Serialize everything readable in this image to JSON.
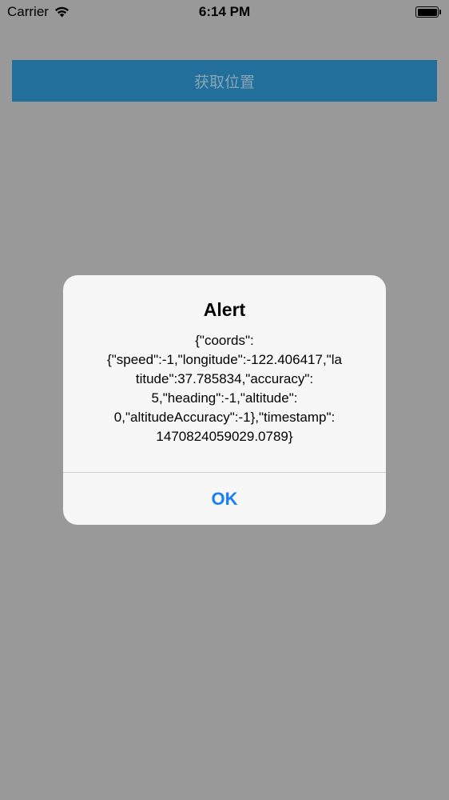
{
  "status_bar": {
    "carrier": "Carrier",
    "time": "6:14 PM",
    "wifi_icon": "wifi-icon",
    "battery_icon": "battery-icon"
  },
  "main": {
    "location_button_label": "获取位置"
  },
  "alert": {
    "title": "Alert",
    "message": "{\"coords\":\n{\"speed\":-1,\"longitude\":-122.406417,\"la\ntitude\":37.785834,\"accuracy\":\n5,\"heading\":-1,\"altitude\":\n0,\"altitudeAccuracy\":-1},\"timestamp\":\n1470824059029.0789}",
    "message_lines": [
      "{\"coords\":",
      "{\"speed\":-1,\"longitude\":-122.406417,\"la",
      "titude\":37.785834,\"accuracy\":",
      "5,\"heading\":-1,\"altitude\":",
      "0,\"altitudeAccuracy\":-1},\"timestamp\":",
      "1470824059029.0789}"
    ],
    "ok_label": "OK"
  },
  "colors": {
    "background": "#999999",
    "button": "#216f9a",
    "button_text": "#8aa5b6",
    "alert_bg": "#f7f7f7",
    "ok_text": "#1a7ef7"
  }
}
